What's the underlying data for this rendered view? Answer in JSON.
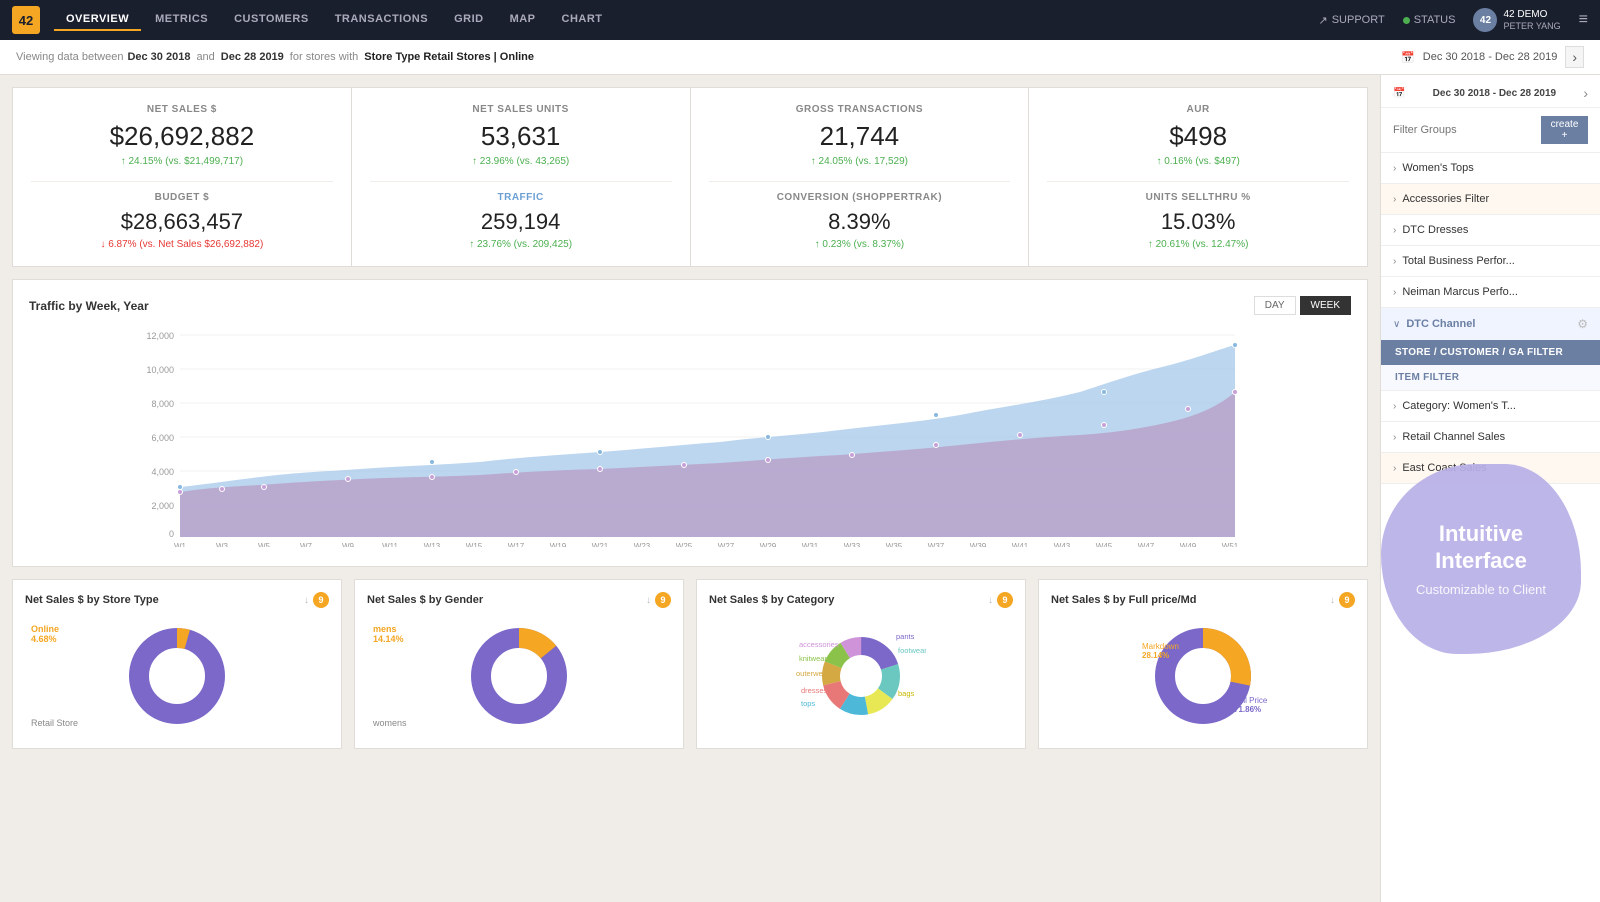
{
  "app": {
    "logo": "42",
    "tabs": [
      {
        "label": "OVERVIEW",
        "active": true
      },
      {
        "label": "METRICS",
        "active": false
      },
      {
        "label": "CUSTOMERS",
        "active": false
      },
      {
        "label": "TRANSACTIONS",
        "active": false
      },
      {
        "label": "GRID",
        "active": false
      },
      {
        "label": "MAP",
        "active": false
      },
      {
        "label": "CHART",
        "active": false
      }
    ],
    "support_label": "SUPPORT",
    "status_label": "STATUS",
    "user": {
      "initials": "42",
      "name": "42 DEMO",
      "sub": "PETER YANG"
    },
    "hamburger": "≡"
  },
  "filter_bar": {
    "viewing_label": "Viewing data between",
    "date_start": "Dec 30 2018",
    "and_label": "and",
    "date_end": "Dec 28 2019",
    "for_stores_label": "for stores with",
    "store_filter": "Store Type Retail Stores | Online",
    "date_range_display": "Dec 30 2018 - Dec 28 2019"
  },
  "kpis": [
    {
      "label": "NET SALES $",
      "value": "$26,692,882",
      "change": "↑ 24.15% (vs. $21,499,717)",
      "change_direction": "up",
      "secondary_label": "BUDGET $",
      "secondary_value": "$28,663,457",
      "secondary_change": "↓ 6.87% (vs. Net Sales $26,692,882)",
      "secondary_direction": "down"
    },
    {
      "label": "NET SALES UNITS",
      "value": "53,631",
      "change": "↑ 23.96% (vs. 43,265)",
      "change_direction": "up",
      "secondary_label": "TRAFFIC",
      "secondary_value": "259,194",
      "secondary_change": "↑ 23.76% (vs. 209,425)",
      "secondary_direction": "up",
      "secondary_is_link": true
    },
    {
      "label": "GROSS TRANSACTIONS",
      "value": "21,744",
      "change": "↑ 24.05% (vs. 17,529)",
      "change_direction": "up",
      "secondary_label": "CONVERSION (SHOPPERTRAK)",
      "secondary_value": "8.39%",
      "secondary_change": "↑ 0.23% (vs. 8.37%)",
      "secondary_direction": "up"
    },
    {
      "label": "AUR",
      "value": "$498",
      "change": "↑ 0.16% (vs. $497)",
      "change_direction": "up",
      "secondary_label": "UNITS SELLTHRU %",
      "secondary_value": "15.03%",
      "secondary_change": "↑ 20.61% (vs. 12.47%)",
      "secondary_direction": "up"
    }
  ],
  "chart": {
    "title": "Traffic by Week, Year",
    "toggle_day": "DAY",
    "toggle_week": "WEEK",
    "y_labels": [
      "12,000",
      "10,000",
      "8,000",
      "6,000",
      "4,000",
      "2,000",
      "0"
    ],
    "x_labels": [
      "W1",
      "W3",
      "W5",
      "W7",
      "W9",
      "W11",
      "W13",
      "W15",
      "W17",
      "W19",
      "W21",
      "W23",
      "W25",
      "W27",
      "W29",
      "W31",
      "W33",
      "W35",
      "W37",
      "W39",
      "W41",
      "W43",
      "W45",
      "W47",
      "W49",
      "W51"
    ]
  },
  "donuts": [
    {
      "title": "Net Sales $ by Store Type",
      "badge": "9",
      "segments": [
        {
          "label": "Online",
          "pct": "4.68%",
          "color": "#f5a623",
          "value": 4.68
        },
        {
          "label": "Retail Store",
          "color": "#7b68c8",
          "value": 95.32
        }
      ]
    },
    {
      "title": "Net Sales $ by Gender",
      "badge": "9",
      "segments": [
        {
          "label": "mens",
          "pct": "14.14%",
          "color": "#f5a623",
          "value": 14.14
        },
        {
          "label": "womens",
          "color": "#7b68c8",
          "value": 85.86
        }
      ]
    },
    {
      "title": "Net Sales $ by Category",
      "badge": "9",
      "segments": [
        {
          "label": "pants",
          "color": "#7b68c8",
          "value": 20
        },
        {
          "label": "footwear",
          "color": "#6bc8c0",
          "value": 15
        },
        {
          "label": "bags",
          "color": "#e8e855",
          "value": 12
        },
        {
          "label": "tops",
          "color": "#4db8d8",
          "value": 12
        },
        {
          "label": "dresses",
          "color": "#e87878",
          "value": 12
        },
        {
          "label": "outerwear",
          "color": "#d4a843",
          "value": 10
        },
        {
          "label": "knitwear",
          "color": "#8bc34a",
          "value": 10
        },
        {
          "label": "accessories",
          "color": "#ce93d8",
          "value": 9
        }
      ]
    },
    {
      "title": "Net Sales $ by Full price/Md",
      "badge": "9",
      "segments": [
        {
          "label": "Markdown",
          "pct": "28.14%",
          "color": "#f5a623",
          "value": 28.14
        },
        {
          "label": "Full Price",
          "pct": "71.86%",
          "color": "#7b68c8",
          "value": 71.86
        }
      ]
    }
  ],
  "sidebar": {
    "date_range": "Dec 30 2018 - Dec 28 2019",
    "filter_placeholder": "Filter Groups",
    "create_btn": "create +",
    "items": [
      {
        "label": "Women's Tops",
        "expanded": false
      },
      {
        "label": "Accessories Filter",
        "expanded": false,
        "highlighted": true
      },
      {
        "label": "DTC Dresses",
        "expanded": false
      },
      {
        "label": "Total Business Perfor...",
        "expanded": false
      },
      {
        "label": "Neiman Marcus Perfo...",
        "expanded": false
      },
      {
        "label": "DTC Channel",
        "expanded": true,
        "active": true
      },
      {
        "label": "Category: Women's T...",
        "expanded": false
      },
      {
        "label": "Retail Channel Sales",
        "expanded": false
      },
      {
        "label": "East Coast Sales",
        "expanded": false,
        "highlighted": true
      }
    ],
    "dtc_subitems": [
      {
        "label": "STORE / CUSTOMER / GA FILTER",
        "active": true
      },
      {
        "label": "ITEM FILTER",
        "active": false
      }
    ]
  },
  "blob": {
    "title": "Intuitive Interface",
    "subtitle": "Customizable to Client"
  }
}
